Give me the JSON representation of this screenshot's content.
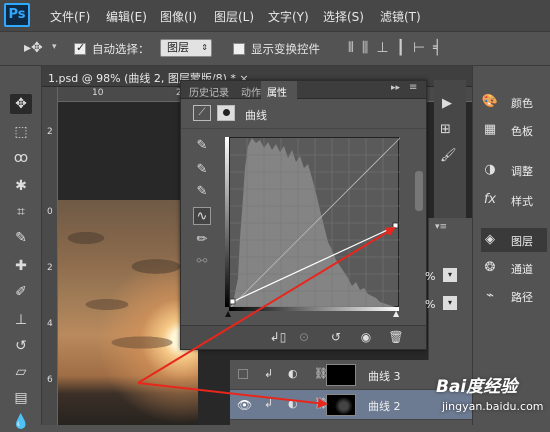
{
  "app": {
    "logo": "Ps"
  },
  "menubar": {
    "items": [
      "文件(F)",
      "编辑(E)",
      "图像(I)",
      "图层(L)",
      "文字(Y)",
      "选择(S)",
      "滤镜(T)"
    ]
  },
  "options": {
    "auto_select_label": "自动选择：",
    "auto_select_checked": true,
    "auto_select_value": "图层",
    "show_transform_label": "显示变换控件",
    "show_transform_checked": false
  },
  "document": {
    "tab_title": "1.psd @ 98% (曲线 2, 图层蒙版/8) * ×",
    "ruler_top": [
      "10",
      "2"
    ],
    "ruler_left": [
      "2",
      "0",
      "2",
      "4",
      "6"
    ]
  },
  "properties_panel": {
    "tabs": [
      "历史记录",
      "动作",
      "属性"
    ],
    "active_tab": "属性",
    "header_title": "曲线"
  },
  "layers": {
    "rows": [
      {
        "name": "曲线 3",
        "visible": false,
        "selected": false
      },
      {
        "name": "曲线 2",
        "visible": true,
        "selected": true
      }
    ],
    "opacity_suffix": "%"
  },
  "dock": {
    "items": [
      {
        "icon": "color-palette-icon",
        "label": "颜色"
      },
      {
        "icon": "swatches-grid-icon",
        "label": "色板"
      },
      {
        "icon": "adjustments-icon",
        "label": "调整"
      },
      {
        "icon": "styles-fx-icon",
        "label": "样式"
      },
      {
        "icon": "layers-stack-icon",
        "label": "图层"
      },
      {
        "icon": "channels-icon",
        "label": "通道"
      },
      {
        "icon": "paths-icon",
        "label": "路径"
      }
    ],
    "active": "图层"
  },
  "watermark": {
    "main": "Bai度经验",
    "sub": "jingyan.baidu.com"
  },
  "colors": {
    "annotation_arrow": "#e8261c",
    "selection": "#6c7a92",
    "ps_blue": "#31a8ff"
  }
}
